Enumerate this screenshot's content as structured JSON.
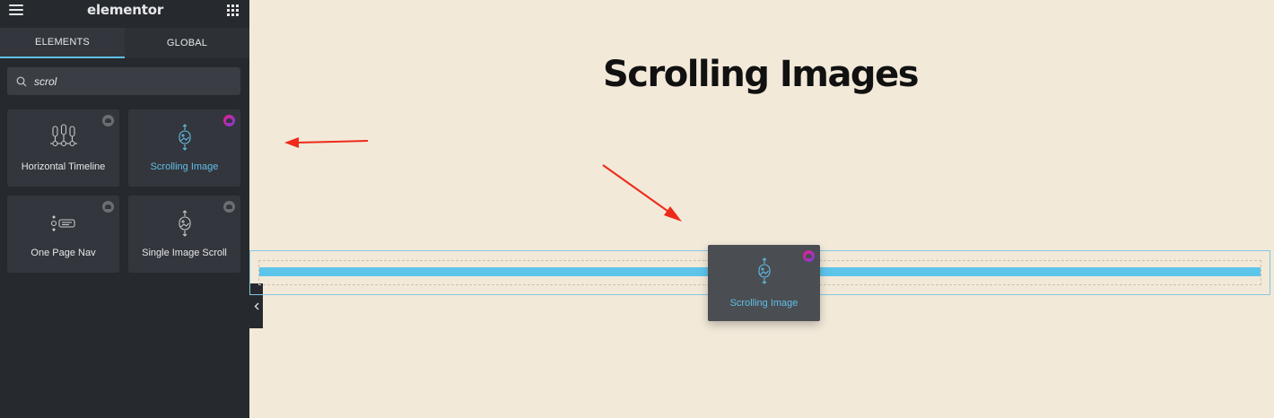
{
  "app": {
    "logo": "elementor"
  },
  "tabs": [
    {
      "label": "ELEMENTS",
      "active": true
    },
    {
      "label": "GLOBAL",
      "active": false
    }
  ],
  "search": {
    "value": "scrol"
  },
  "widgets": [
    {
      "label": "Horizontal Timeline",
      "icon": "timeline-icon",
      "pro": false,
      "highlighted": false
    },
    {
      "label": "Scrolling Image",
      "icon": "scrolling-image-icon",
      "pro": true,
      "highlighted": true
    },
    {
      "label": "One Page Nav",
      "icon": "one-page-nav-icon",
      "pro": false,
      "highlighted": false
    },
    {
      "label": "Single Image Scroll",
      "icon": "single-image-scroll-icon",
      "pro": false,
      "highlighted": false
    }
  ],
  "canvas": {
    "heading": "Scrolling Images",
    "dragging_widget": {
      "label": "Scrolling Image",
      "icon": "scrolling-image-icon"
    }
  },
  "colors": {
    "accent": "#61bfe6",
    "panel": "#26292e",
    "canvas": "#f2e9d9",
    "annotation": "#ee2a1a"
  }
}
